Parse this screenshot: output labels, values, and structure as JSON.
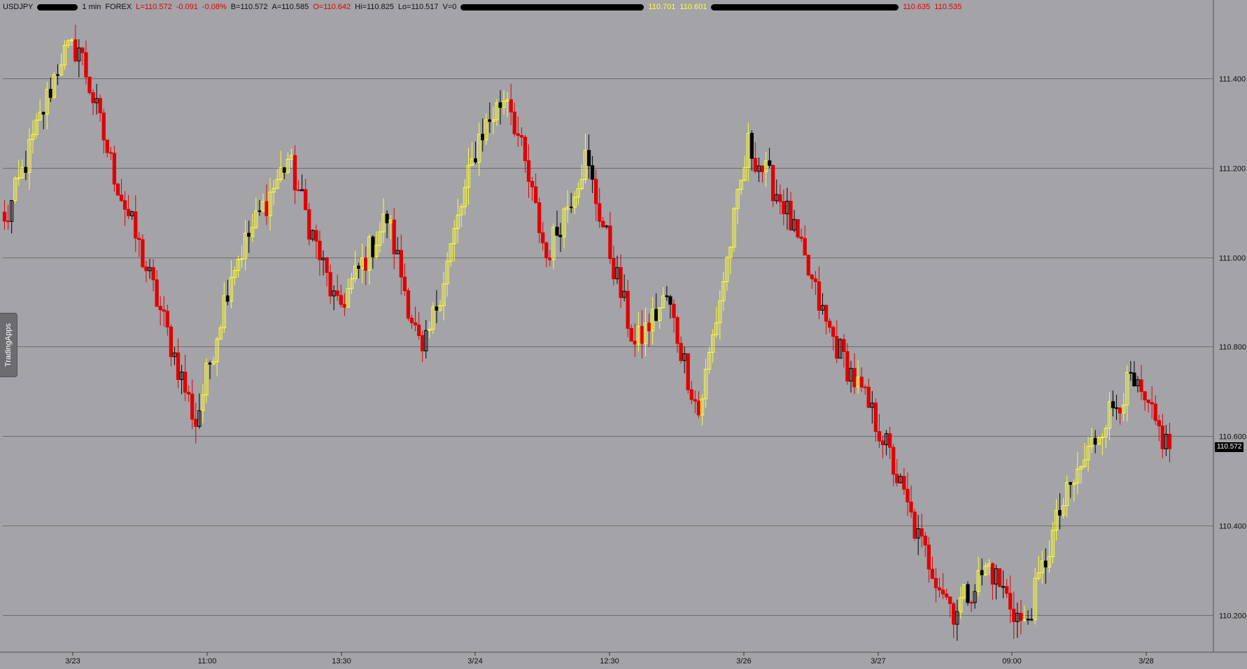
{
  "header": {
    "symbol": "USDJPY",
    "interval": "1 min",
    "market": "FOREX",
    "last": "L=110.572",
    "change": "-0.091",
    "change_pct": "-0.08%",
    "bid": "B=110.572",
    "ask": "A=110.585",
    "open": "O=110.642",
    "high": "Hi=110.825",
    "low": "Lo=110.517",
    "volume": "V=0",
    "ind1_a": "110.701",
    "ind1_b": "110.601",
    "ind2_a": "110.635",
    "ind2_b": "110.535"
  },
  "side_tab": {
    "label": "TradingApps"
  },
  "price_tag": {
    "label": "110.572"
  },
  "colors": {
    "background": "#a3a3a8",
    "up_hollow_yellow": "#ffff33",
    "down_red": "#e00000",
    "black_bar": "#000000",
    "gridline": "#6e6e6e"
  },
  "chart_data": {
    "type": "candlestick",
    "title": "USDJPY 1 min FOREX",
    "ylim": [
      110.117,
      111.55
    ],
    "y_ticks": [
      {
        "value": 111.4,
        "label": "111.400"
      },
      {
        "value": 111.2,
        "label": "111.200"
      },
      {
        "value": 111.0,
        "label": "111.000"
      },
      {
        "value": 110.8,
        "label": "110.800"
      },
      {
        "value": 110.6,
        "label": "110.600"
      },
      {
        "value": 110.4,
        "label": "110.400"
      },
      {
        "value": 110.2,
        "label": "110.200"
      }
    ],
    "x_labels": [
      "3/23",
      "11:00",
      "13:30",
      "3/24",
      "12:30",
      "3/26",
      "3/27",
      "09:00",
      "3/28"
    ],
    "bar_count": 330,
    "grid": true,
    "last_price": 110.572,
    "close_path": [
      {
        "bar": 0,
        "value": 111.07
      },
      {
        "bar": 16,
        "value": 111.45
      },
      {
        "bar": 21,
        "value": 111.47
      },
      {
        "bar": 30,
        "value": 111.21
      },
      {
        "bar": 44,
        "value": 110.88
      },
      {
        "bar": 54,
        "value": 110.63
      },
      {
        "bar": 64,
        "value": 110.97
      },
      {
        "bar": 80,
        "value": 111.22
      },
      {
        "bar": 94,
        "value": 110.88
      },
      {
        "bar": 108,
        "value": 111.09
      },
      {
        "bar": 118,
        "value": 110.77
      },
      {
        "bar": 134,
        "value": 111.27
      },
      {
        "bar": 142,
        "value": 111.37
      },
      {
        "bar": 153,
        "value": 111.0
      },
      {
        "bar": 164,
        "value": 111.22
      },
      {
        "bar": 178,
        "value": 110.8
      },
      {
        "bar": 187,
        "value": 110.91
      },
      {
        "bar": 196,
        "value": 110.65
      },
      {
        "bar": 210,
        "value": 111.25
      },
      {
        "bar": 220,
        "value": 111.12
      },
      {
        "bar": 232,
        "value": 110.85
      },
      {
        "bar": 248,
        "value": 110.6
      },
      {
        "bar": 258,
        "value": 110.37
      },
      {
        "bar": 268,
        "value": 110.21
      },
      {
        "bar": 278,
        "value": 110.31
      },
      {
        "bar": 288,
        "value": 110.17
      },
      {
        "bar": 298,
        "value": 110.43
      },
      {
        "bar": 310,
        "value": 110.63
      },
      {
        "bar": 318,
        "value": 110.72
      },
      {
        "bar": 329,
        "value": 110.57
      }
    ]
  }
}
